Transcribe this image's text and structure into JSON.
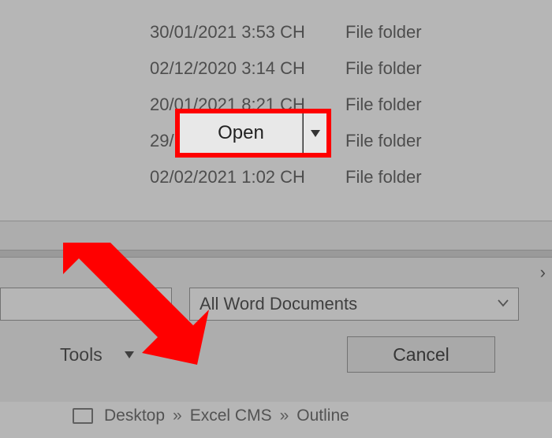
{
  "files": [
    {
      "date": "30/01/2021 3:53 CH",
      "type": "File folder"
    },
    {
      "date": "02/12/2020 3:14 CH",
      "type": "File folder"
    },
    {
      "date": "20/01/2021 8:21 CH",
      "type": "File folder"
    },
    {
      "date": "29/11/2020 12:00 ...",
      "type": "File folder"
    },
    {
      "date": "02/02/2021 1:02 CH",
      "type": "File folder"
    }
  ],
  "filter": {
    "selected": "All Word Documents"
  },
  "buttons": {
    "tools": "Tools",
    "open": "Open",
    "cancel": "Cancel"
  },
  "breadcrumb": {
    "parts": [
      "Desktop",
      "Excel CMS",
      "Outline"
    ],
    "sep": "»"
  },
  "scroll_right_glyph": "›"
}
